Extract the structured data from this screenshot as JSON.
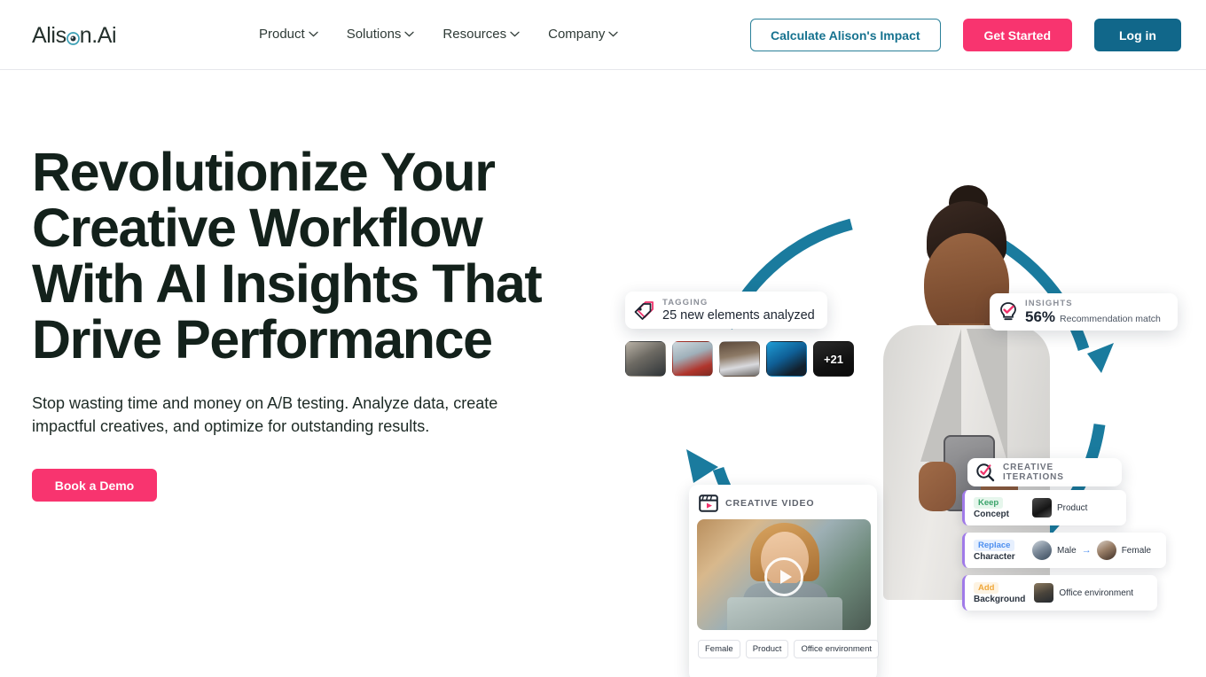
{
  "brand": {
    "name_part1": "Alis",
    "name_part2": "n.Ai",
    "logo_mark_icon": "target-eye-icon",
    "accent_teal": "#11678a",
    "accent_pink": "#f8346f",
    "headline_color": "#13211b"
  },
  "nav": {
    "items": [
      {
        "label": "Product",
        "icon": "chevron-down-icon"
      },
      {
        "label": "Solutions",
        "icon": "chevron-down-icon"
      },
      {
        "label": "Resources",
        "icon": "chevron-down-icon"
      },
      {
        "label": "Company",
        "icon": "chevron-down-icon"
      }
    ]
  },
  "actions": {
    "calculate_label": "Calculate Alison's Impact",
    "get_started_label": "Get Started",
    "login_label": "Log in"
  },
  "hero": {
    "headline": "Revolutionize Your Creative Workflow With AI Insights That Drive Performance",
    "subhead": "Stop wasting time and money on A/B testing. Analyze data, create impactful creatives, and optimize for outstanding results.",
    "cta_label": "Book a Demo"
  },
  "art": {
    "cycle_color": "#1a7b9e",
    "tagging": {
      "label": "TAGGING",
      "value": "25 new elements analyzed",
      "icon": "tag-icon",
      "thumbs": [
        {
          "name": "thumbnail-fashion"
        },
        {
          "name": "thumbnail-food"
        },
        {
          "name": "thumbnail-car"
        },
        {
          "name": "thumbnail-gaming"
        },
        {
          "name": "thumbnail-more",
          "overlay": "+21"
        }
      ]
    },
    "insights": {
      "label": "INSIGHTS",
      "percent": "56%",
      "text": "Recommendation match",
      "icon": "lightbulb-icon"
    },
    "iterations": {
      "label": "CREATIVE ITERATIONS",
      "icon": "magnifier-check-icon",
      "rows": [
        {
          "action": "Keep",
          "category": "Concept",
          "value": "Product",
          "from": "",
          "to": ""
        },
        {
          "action": "Replace",
          "category": "Character",
          "from": "Male",
          "to": "Female",
          "arrow": "→",
          "value": ""
        },
        {
          "action": "Add",
          "category": "Background",
          "value": "Office environment",
          "from": "",
          "to": ""
        }
      ]
    },
    "video": {
      "label": "CREATIVE VIDEO",
      "icon": "clapperboard-icon",
      "play_icon": "play-icon",
      "tags": [
        "Female",
        "Product",
        "Office environment"
      ]
    }
  }
}
